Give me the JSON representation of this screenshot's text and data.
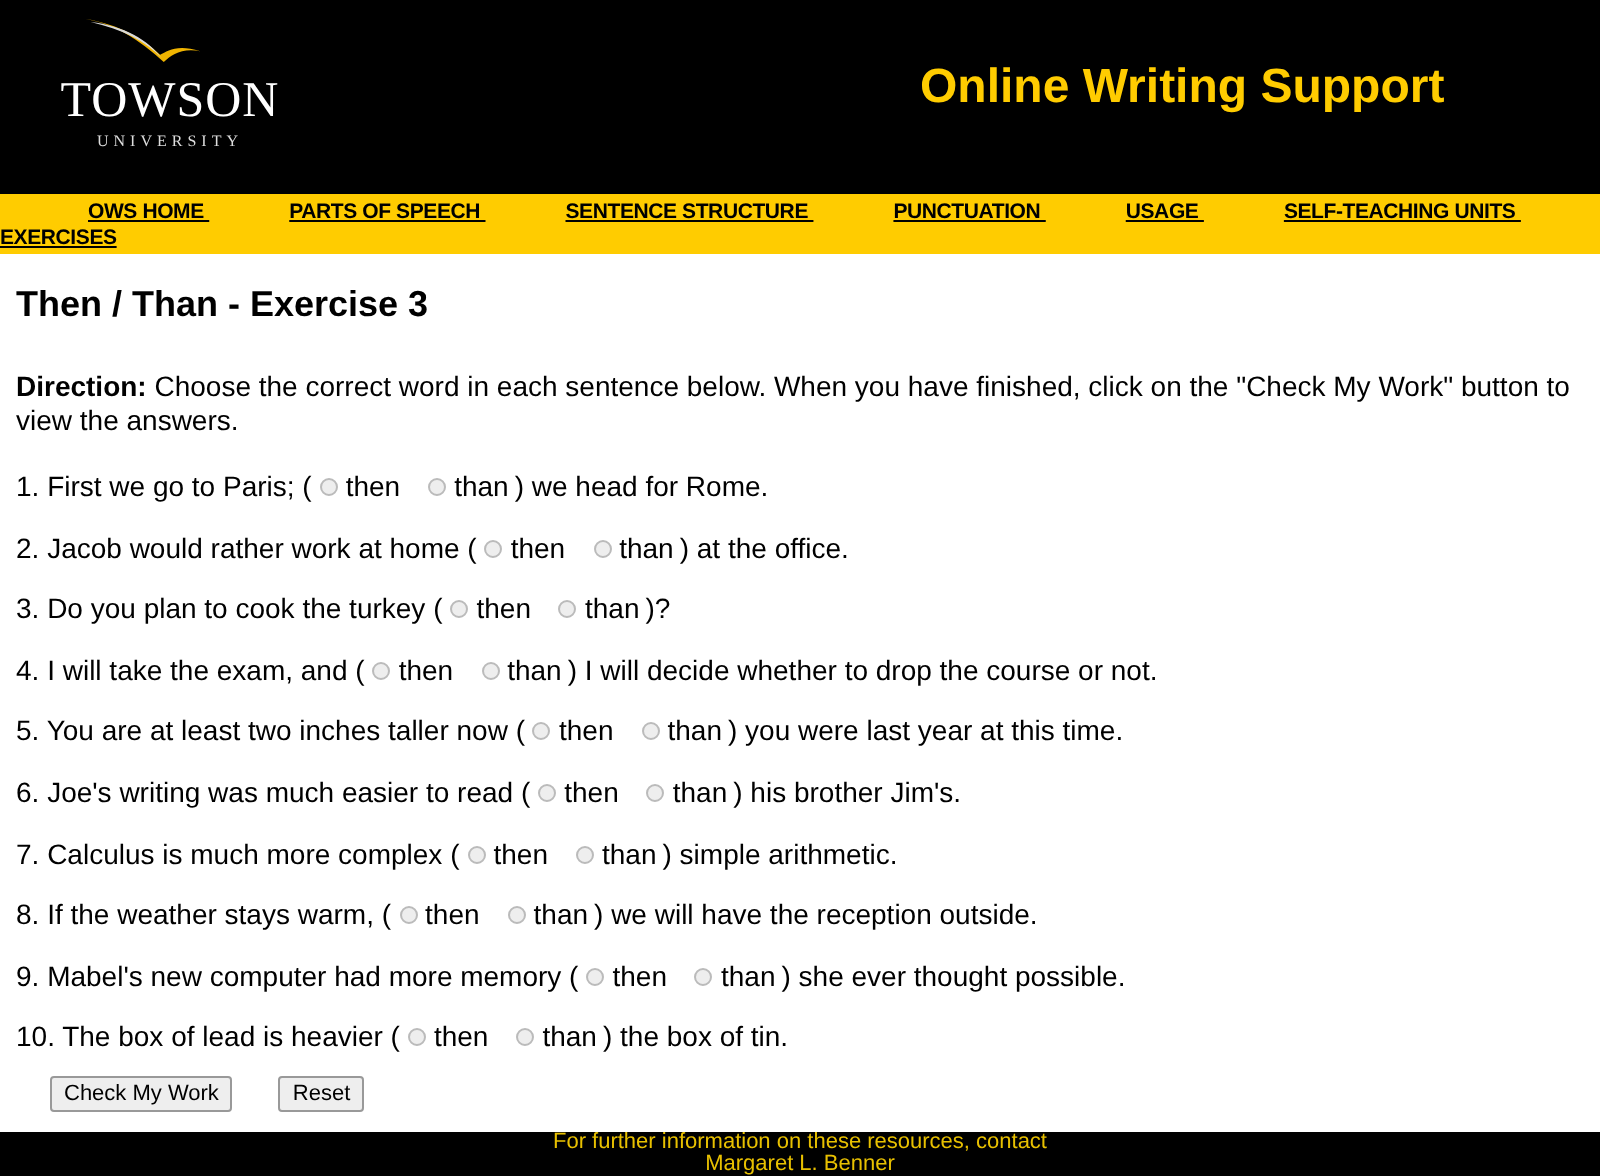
{
  "header": {
    "logo_name": "TOWSON",
    "logo_sub": "UNIVERSITY",
    "title": "Online Writing Support"
  },
  "nav": [
    {
      "label": "OWS HOME "
    },
    {
      "label": "PARTS OF SPEECH "
    },
    {
      "label": "SENTENCE STRUCTURE "
    },
    {
      "label": "PUNCTUATION "
    },
    {
      "label": "USAGE "
    },
    {
      "label": "SELF-TEACHING UNITS "
    },
    {
      "label": "EXERCISES"
    }
  ],
  "heading": "Then / Than - Exercise 3",
  "direction": "**Direction:** Choose the correct word in each sentence below. When you have finished, click on the \"Check My Work\" button to view the answers.",
  "questions": [
    {
      "before": "1. First we go to Paris; (",
      "options": [
        {
          "label": "then",
          "selected": false
        },
        {
          "label": "than",
          "selected": false
        }
      ],
      "after": ") we head for Rome."
    },
    {
      "before": "2. Jacob would rather work at home (",
      "options": [
        {
          "label": "then",
          "selected": false
        },
        {
          "label": "than",
          "selected": false
        }
      ],
      "after": ") at the office."
    },
    {
      "before": "3. Do you plan to cook the turkey (",
      "options": [
        {
          "label": "then",
          "selected": false
        },
        {
          "label": "than",
          "selected": false
        }
      ],
      "after": ")?"
    },
    {
      "before": "4. I will take the exam, and (",
      "options": [
        {
          "label": "then",
          "selected": false
        },
        {
          "label": "than",
          "selected": false
        }
      ],
      "after": ") I will decide whether to drop the course or not."
    },
    {
      "before": "5. You are at least two inches taller now (",
      "options": [
        {
          "label": "then",
          "selected": false
        },
        {
          "label": "than",
          "selected": false
        }
      ],
      "after": ") you were last year at this time."
    },
    {
      "before": "6. Joe's writing was much easier to read (",
      "options": [
        {
          "label": "then",
          "selected": false
        },
        {
          "label": "than",
          "selected": false
        }
      ],
      "after": ") his brother Jim's."
    },
    {
      "before": "7. Calculus is much more complex (",
      "options": [
        {
          "label": "then",
          "selected": false
        },
        {
          "label": "than",
          "selected": false
        }
      ],
      "after": ") simple arithmetic."
    },
    {
      "before": "8. If the weather stays warm, (",
      "options": [
        {
          "label": "then",
          "selected": false
        },
        {
          "label": "than",
          "selected": false
        }
      ],
      "after": ") we will have the reception outside."
    },
    {
      "before": "9. Mabel's new computer had more memory (",
      "options": [
        {
          "label": "then",
          "selected": false
        },
        {
          "label": "than",
          "selected": false
        }
      ],
      "after": ") she ever thought possible."
    },
    {
      "before": "10. The box of lead is heavier (",
      "options": [
        {
          "label": "then",
          "selected": false
        },
        {
          "label": "than",
          "selected": false
        }
      ],
      "after": ") the box of tin."
    }
  ],
  "buttons": [
    "Check My Work",
    "Reset"
  ],
  "footer": [
    "For further information on these resources, contact",
    "Margaret L. Benner"
  ]
}
